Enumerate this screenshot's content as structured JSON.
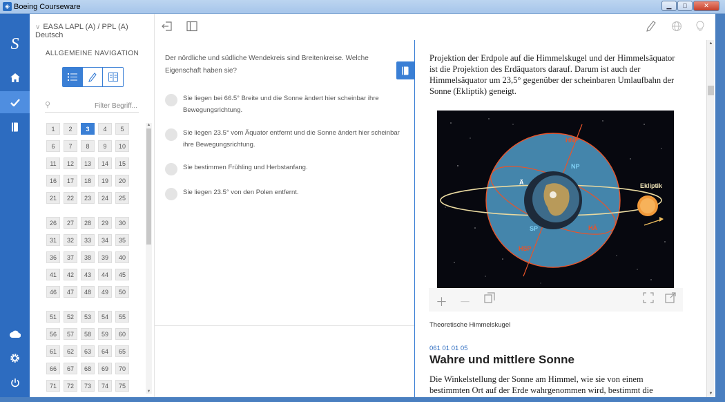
{
  "window": {
    "title": "Boeing Courseware",
    "minimize": "▁",
    "maximize": "□",
    "close": "✕"
  },
  "rail": {
    "logo": "S"
  },
  "nav": {
    "course": "EASA LAPL (A) / PPL (A) Deutsch",
    "heading": "ALLGEMEINE NAVIGATION",
    "filter_placeholder": "Filter Begriff...",
    "active_number": "3",
    "rows": [
      [
        "1",
        "2",
        "3",
        "4",
        "5"
      ],
      [
        "6",
        "7",
        "8",
        "9",
        "10"
      ],
      [
        "11",
        "12",
        "13",
        "14",
        "15"
      ],
      [
        "16",
        "17",
        "18",
        "19",
        "20"
      ],
      [
        "21",
        "22",
        "23",
        "24",
        "25"
      ],
      [
        "26",
        "27",
        "28",
        "29",
        "30"
      ],
      [
        "31",
        "32",
        "33",
        "34",
        "35"
      ],
      [
        "36",
        "37",
        "38",
        "39",
        "40"
      ],
      [
        "41",
        "42",
        "43",
        "44",
        "45"
      ],
      [
        "46",
        "47",
        "48",
        "49",
        "50"
      ],
      [
        "51",
        "52",
        "53",
        "54",
        "55"
      ],
      [
        "56",
        "57",
        "58",
        "59",
        "60"
      ],
      [
        "61",
        "62",
        "63",
        "64",
        "65"
      ],
      [
        "66",
        "67",
        "68",
        "69",
        "70"
      ],
      [
        "71",
        "72",
        "73",
        "74",
        "75"
      ]
    ]
  },
  "question": {
    "text": "Der nördliche und südliche Wendekreis sind Breitenkreise. Welche Eigenschaft haben sie?",
    "answers": [
      "Sie liegen bei 66.5° Breite und die Sonne ändert hier scheinbar ihre Bewegungsrichtung.",
      "Sie liegen 23.5° vom Äquator entfernt und die Sonne ändert hier scheinbar ihre Bewegungsrichtung.",
      "Sie bestimmen Frühling und Herbstanfang.",
      "Sie liegen 23.5° von den Polen entfernt."
    ]
  },
  "content": {
    "paragraph1": "Projektion der Erdpole auf die Himmelskugel und der Himmelsäquator ist die Projektion des Erdäquators darauf. Darum ist auch der Himmelsäquator um 23,5° gegenüber der scheinbaren Umlaufbahn der Sonne (Ekliptik) geneigt.",
    "figure_labels": {
      "hnp": "HNP",
      "np": "NP",
      "ae": "Ä",
      "ekliptik": "Ekliptik",
      "sp": "SP",
      "ha": "HÄ",
      "hsp": "HSP"
    },
    "caption": "Theoretische Himmelskugel",
    "section_number": "061 01 01 05",
    "section_title": "Wahre und mittlere Sonne",
    "paragraph2": "Die Winkelstellung der Sonne am Himmel, wie sie von einem bestimmten Ort auf der Erde wahrgenommen wird, bestimmt die Tageszeit an diesem Ort. Darauf wird im Kapitel Zeitrechnung näher"
  },
  "colors": {
    "accent": "#3a7fd5",
    "rail": "#2d6cc0",
    "sphere": "#4a90b8",
    "pole_label": "#e8542a",
    "np_label": "#7fd0f5"
  }
}
